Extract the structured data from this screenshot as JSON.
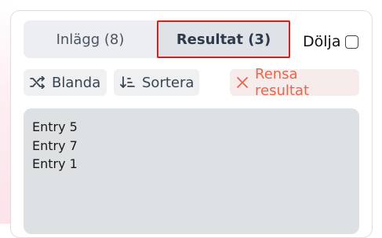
{
  "tabs": [
    {
      "label": "Inlägg (8)",
      "active": false
    },
    {
      "label": "Resultat (3)",
      "active": true
    }
  ],
  "hide_toggle": {
    "label": "Dölja",
    "checked": false
  },
  "actions": {
    "shuffle": {
      "label": "Blanda",
      "icon": "shuffle-icon"
    },
    "sort": {
      "label": "Sortera",
      "icon": "sort-icon"
    },
    "clear": {
      "label": "Rensa resultat",
      "icon": "close-icon"
    }
  },
  "results": [
    "Entry 5",
    "Entry 7",
    "Entry 1"
  ],
  "colors": {
    "highlight": "#e01b1b",
    "clear_text": "#e9664d",
    "results_bg": "#dde1e3"
  }
}
